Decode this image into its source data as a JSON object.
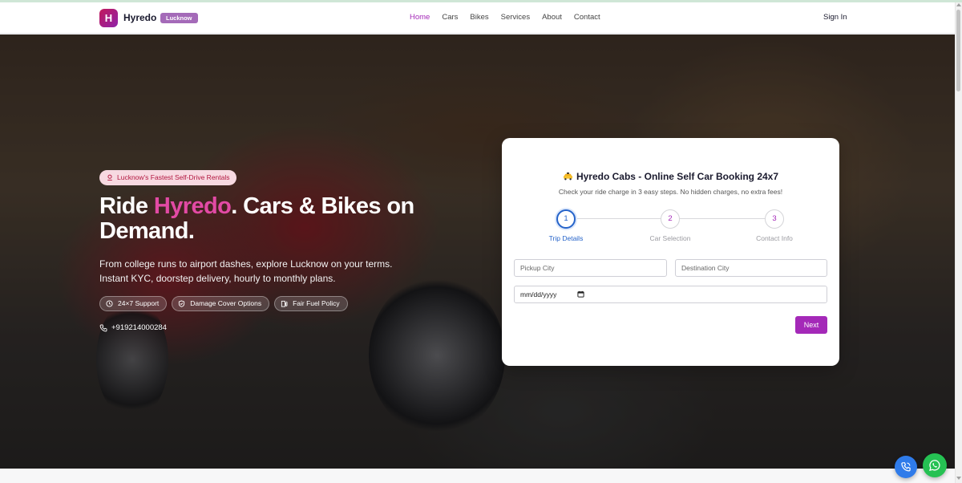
{
  "header": {
    "logo_letter": "H",
    "brand": "Hyredo",
    "city_badge": "Lucknow",
    "nav": [
      {
        "label": "Home",
        "active": true
      },
      {
        "label": "Cars"
      },
      {
        "label": "Bikes"
      },
      {
        "label": "Services"
      },
      {
        "label": "About"
      },
      {
        "label": "Contact"
      }
    ],
    "signin": "Sign In"
  },
  "hero": {
    "tag": "Lucknow's Fastest Self-Drive Rentals",
    "headline_pre": "Ride ",
    "headline_accent": "Hyredo",
    "headline_post": ". Cars & Bikes on Demand.",
    "subtitle_line1": "From college runs to airport dashes, explore Lucknow on your terms.",
    "subtitle_line2": "Instant KYC, doorstep delivery, hourly to monthly plans.",
    "pills": [
      "24×7 Support",
      "Damage Cover Options",
      "Fair Fuel Policy"
    ],
    "phone": "+919214000284"
  },
  "booking": {
    "title": "Hyredo Cabs - Online Self Car Booking 24x7",
    "subtitle": "Check your ride charge in 3 easy steps. No hidden charges, no extra fees!",
    "steps": [
      {
        "num": "1",
        "label": "Trip Details",
        "active": true
      },
      {
        "num": "2",
        "label": "Car Selection"
      },
      {
        "num": "3",
        "label": "Contact Info"
      }
    ],
    "pickup_placeholder": "Pickup City",
    "destination_placeholder": "Destination City",
    "date_value": "mm/dd/yyyy",
    "next_label": "Next"
  },
  "colors": {
    "accent": "#a429b8",
    "headline_accent": "#e24aa5",
    "active_step": "#2563c9",
    "whatsapp": "#25c153",
    "call": "#2f7bea"
  },
  "icons": [
    "location-pin-icon",
    "clock-icon",
    "shield-icon",
    "fuel-icon",
    "phone-icon",
    "taxi-icon",
    "calendar-icon",
    "phone-call-icon",
    "whatsapp-icon"
  ]
}
